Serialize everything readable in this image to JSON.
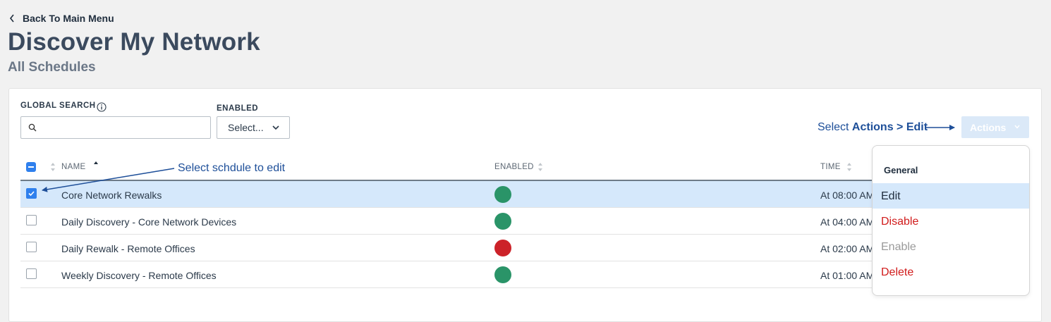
{
  "nav": {
    "back_label": "Back To Main Menu"
  },
  "page": {
    "title": "Discover My Network",
    "subtitle": "All Schedules"
  },
  "filters": {
    "global_search_label": "GLOBAL SEARCH",
    "global_search_value": "",
    "enabled_label": "ENABLED",
    "enabled_value": "Select..."
  },
  "annotations": {
    "actions_hint_prefix": "Select ",
    "actions_hint_bold": "Actions > Edit",
    "edit_hint": "Select schdule to edit"
  },
  "actions_button": {
    "label": "Actions"
  },
  "table": {
    "columns": {
      "name": "NAME",
      "enabled": "ENABLED",
      "time": "TIME"
    },
    "rows": [
      {
        "name": "Core Network Rewalks",
        "enabled": true,
        "time": "At 08:00 AM",
        "checked": true
      },
      {
        "name": "Daily Discovery - Core Network Devices",
        "enabled": true,
        "time": "At 04:00 AM",
        "checked": false
      },
      {
        "name": "Daily Rewalk - Remote Offices",
        "enabled": false,
        "time": "At 02:00 AM",
        "checked": false
      },
      {
        "name": "Weekly Discovery - Remote Offices",
        "enabled": true,
        "time": "At 01:00 AM",
        "checked": false
      }
    ]
  },
  "actions_menu": {
    "group_label": "General",
    "items": [
      {
        "label": "Edit",
        "state": "active"
      },
      {
        "label": "Disable",
        "state": "danger"
      },
      {
        "label": "Enable",
        "state": "disabled"
      },
      {
        "label": "Delete",
        "state": "danger"
      }
    ]
  },
  "colors": {
    "enabled_dot": "#2a9468",
    "disabled_dot": "#cc2229",
    "danger_text": "#d11b1b",
    "disabled_text": "#9a9a9a",
    "accent": "#2f80ed",
    "annotation": "#1e4f99",
    "selected_row": "#d5e8fb"
  },
  "icons": {
    "back": "chevron-left-icon",
    "info": "info-icon",
    "search": "search-icon",
    "dropdown": "chevron-down-icon",
    "sort": "sort-icon",
    "checkbox": "checkbox-icon",
    "status": "status-dot-icon"
  }
}
